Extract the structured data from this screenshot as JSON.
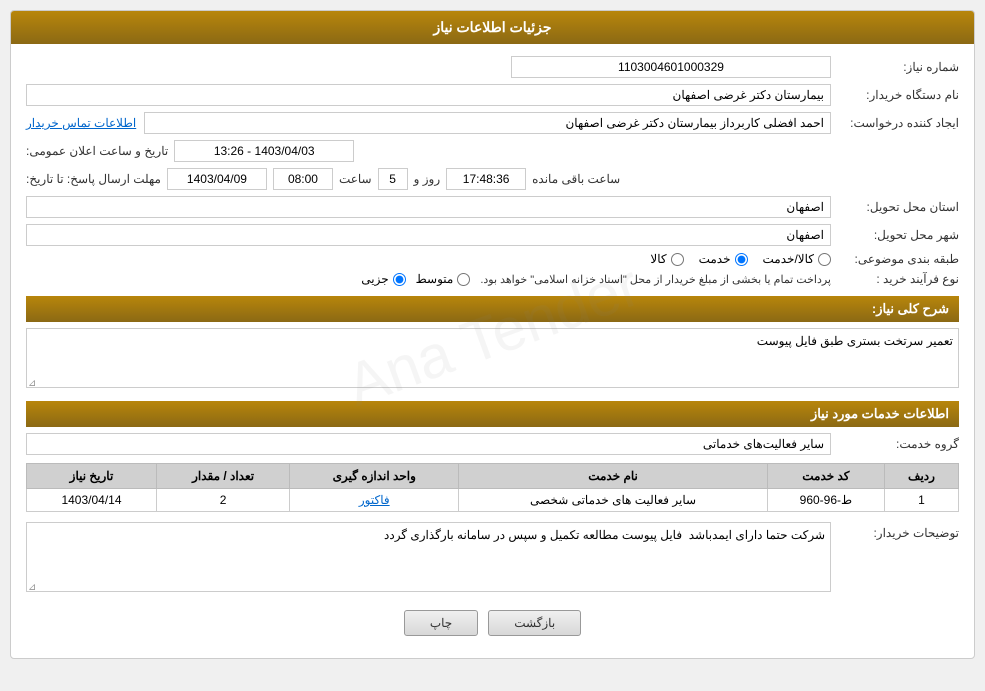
{
  "header": {
    "title": "جزئیات اطلاعات نیاز"
  },
  "fields": {
    "need_number_label": "شماره نیاز:",
    "need_number_value": "1103004601000329",
    "org_name_label": "نام دستگاه خریدار:",
    "org_name_value": "بیمارستان دکتر غرضی اصفهان",
    "creator_label": "ایجاد کننده درخواست:",
    "creator_value": "احمد افضلی کاربرداز بیمارستان دکتر غرضی اصفهان",
    "creator_link": "اطلاعات تماس خریدار",
    "announce_date_label": "تاریخ و ساعت اعلان عمومی:",
    "announce_date_value": "1403/04/03 - 13:26",
    "deadline_label": "مهلت ارسال پاسخ: تا تاریخ:",
    "deadline_date": "1403/04/09",
    "deadline_time_label": "ساعت",
    "deadline_time": "08:00",
    "deadline_days_label": "روز و",
    "deadline_days": "5",
    "deadline_remaining_label": "ساعت باقی مانده",
    "deadline_remaining": "17:48:36",
    "province_label": "استان محل تحویل:",
    "province_value": "اصفهان",
    "city_label": "شهر محل تحویل:",
    "city_value": "اصفهان",
    "category_label": "طبقه بندی موضوعی:",
    "category_options": [
      {
        "label": "کالا",
        "value": "kala"
      },
      {
        "label": "خدمت",
        "value": "khadamat"
      },
      {
        "label": "کالا/خدمت",
        "value": "kala_khadamat"
      }
    ],
    "category_selected": "khadamat",
    "purchase_type_label": "نوع فرآیند خرید :",
    "purchase_type_options": [
      {
        "label": "جزیی",
        "value": "jozii"
      },
      {
        "label": "متوسط",
        "value": "motavaset"
      }
    ],
    "purchase_type_selected": "jozii",
    "purchase_type_note": "پرداخت تمام یا بخشی از مبلغ خریدار از محل \"اسناد خزانه اسلامی\" خواهد بود.",
    "description_label": "شرح کلی نیاز:",
    "description_value": "تعمیر سرتخت بستری طبق فایل پیوست",
    "services_section_label": "اطلاعات خدمات مورد نیاز",
    "service_group_label": "گروه خدمت:",
    "service_group_value": "سایر فعالیت‌های خدماتی",
    "table_headers": [
      "ردیف",
      "کد خدمت",
      "نام خدمت",
      "واحد اندازه گیری",
      "تعداد / مقدار",
      "تاریخ نیاز"
    ],
    "table_rows": [
      {
        "row": "1",
        "code": "ط-96-960",
        "name": "سایر فعالیت های خدماتی شخصی",
        "unit": "فاکتور",
        "quantity": "2",
        "date": "1403/04/14"
      }
    ],
    "buyer_desc_label": "توضیحات خریدار:",
    "buyer_desc_value": "شرکت حتما دارای ایمدباشد  فایل پیوست مطالعه تکمیل و سپس در سامانه بارگذاری گردد"
  },
  "buttons": {
    "print": "چاپ",
    "back": "بازگشت"
  }
}
